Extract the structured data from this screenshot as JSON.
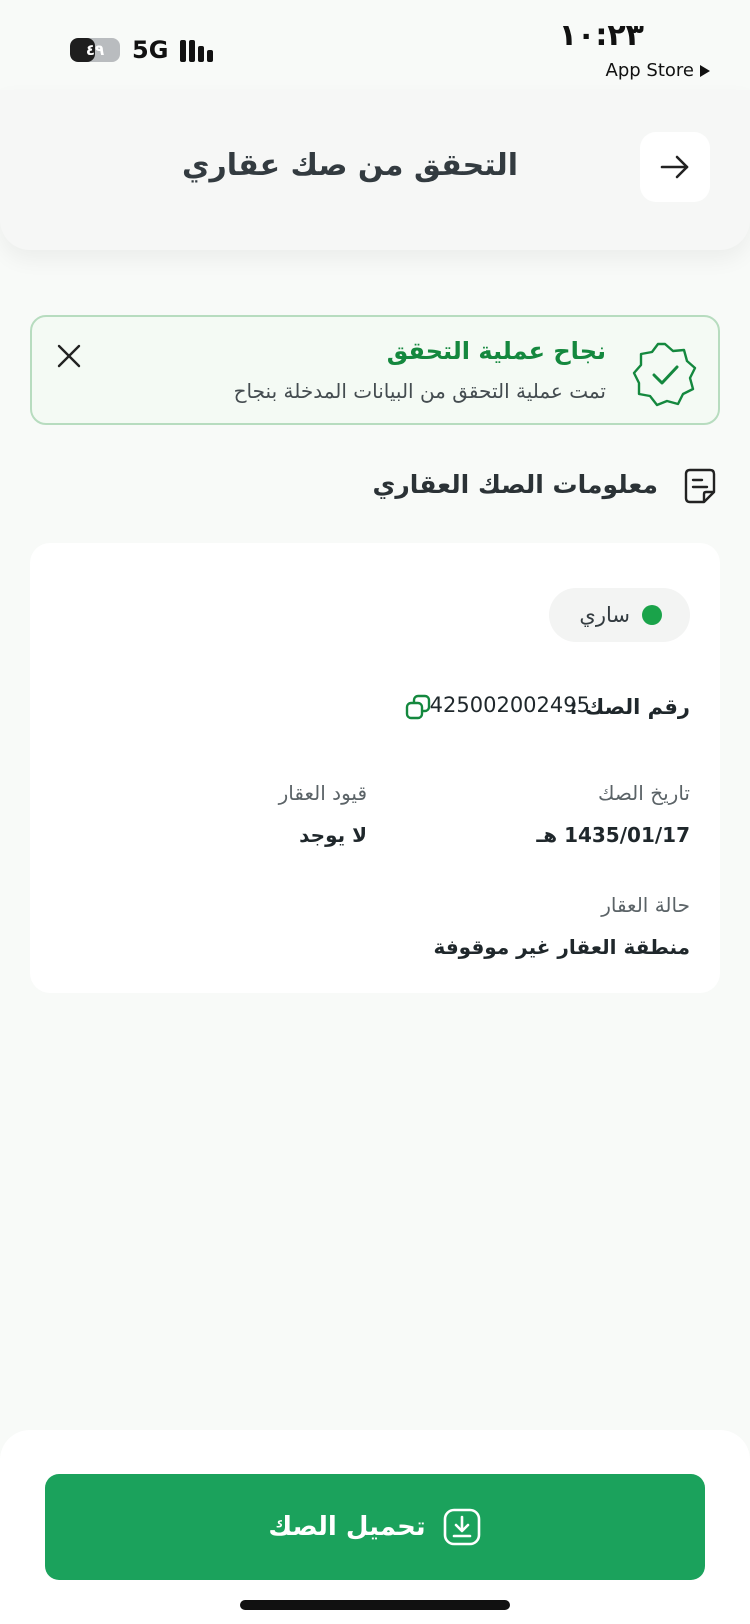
{
  "status_bar": {
    "battery_label": "٤٩",
    "battery_level": 0.49,
    "network": "5G",
    "time": "١٠:٢٣",
    "back_app": "App Store"
  },
  "header": {
    "title": "التحقق من صك عقاري",
    "back_icon": "arrow-right-icon"
  },
  "success_banner": {
    "title": "نجاح عملية التحقق",
    "message": "تمت عملية التحقق من البيانات المدخلة بنجاح",
    "badge_icon": "verified-badge-icon",
    "close_icon": "close-icon"
  },
  "section": {
    "title": "معلومات الصك العقاري",
    "icon": "document-icon"
  },
  "deed": {
    "status": "ساري",
    "number_label": "رقم الصك :",
    "number_value": "425002002495",
    "date_label": "تاريخ الصك",
    "date_value": "1435/01/17 هـ",
    "restrictions_label": "قيود العقار",
    "restrictions_value": "لا يوجد",
    "property_status_label": "حالة العقار",
    "property_status_value": "منطقة العقار غير موقوفة"
  },
  "actions": {
    "download_label": "تحميل الصك",
    "download_icon": "download-icon"
  },
  "colors": {
    "primary_green": "#1ba25c",
    "success_text": "#14883e",
    "status_dot": "#1aa34a",
    "banner_border": "#b7dcbf"
  }
}
